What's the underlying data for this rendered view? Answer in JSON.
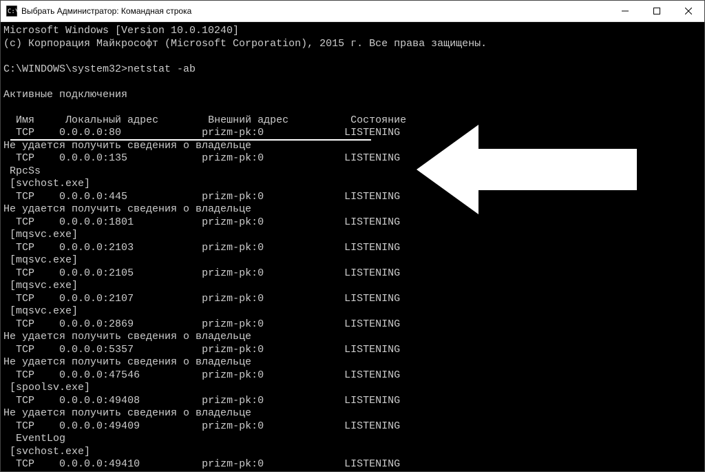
{
  "window": {
    "title": "Выбрать Администратор: Командная строка"
  },
  "terminal": {
    "header1": "Microsoft Windows [Version 10.0.10240]",
    "header2": "(с) Корпорация Майкрософт (Microsoft Corporation), 2015 г. Все права защищены.",
    "prompt": "C:\\WINDOWS\\system32>netstat -ab",
    "section_title": "Активные подключения",
    "col_proto": "Имя",
    "col_local": "Локальный адрес",
    "col_foreign": "Внешний адрес",
    "col_state": "Состояние",
    "owner_fail": "Не удается получить сведения о владельце",
    "proc_rpcss": " RpcSs",
    "proc_svchost": " [svchost.exe]",
    "proc_mqsvc": " [mqsvc.exe]",
    "proc_spoolsv": " [spoolsv.exe]",
    "proc_eventlog": "  EventLog",
    "foreign": "prizm-pk:0",
    "state": "LISTENING",
    "rows": {
      "r80": {
        "proto": "TCP",
        "local": "0.0.0.0:80"
      },
      "r135": {
        "proto": "TCP",
        "local": "0.0.0.0:135"
      },
      "r445": {
        "proto": "TCP",
        "local": "0.0.0.0:445"
      },
      "r1801": {
        "proto": "TCP",
        "local": "0.0.0.0:1801"
      },
      "r2103": {
        "proto": "TCP",
        "local": "0.0.0.0:2103"
      },
      "r2105": {
        "proto": "TCP",
        "local": "0.0.0.0:2105"
      },
      "r2107": {
        "proto": "TCP",
        "local": "0.0.0.0:2107"
      },
      "r2869": {
        "proto": "TCP",
        "local": "0.0.0.0:2869"
      },
      "r5357": {
        "proto": "TCP",
        "local": "0.0.0.0:5357"
      },
      "r47546": {
        "proto": "TCP",
        "local": "0.0.0.0:47546"
      },
      "r49408": {
        "proto": "TCP",
        "local": "0.0.0.0:49408"
      },
      "r49409": {
        "proto": "TCP",
        "local": "0.0.0.0:49409"
      },
      "r49410": {
        "proto": "TCP",
        "local": "0.0.0.0:49410"
      }
    }
  }
}
